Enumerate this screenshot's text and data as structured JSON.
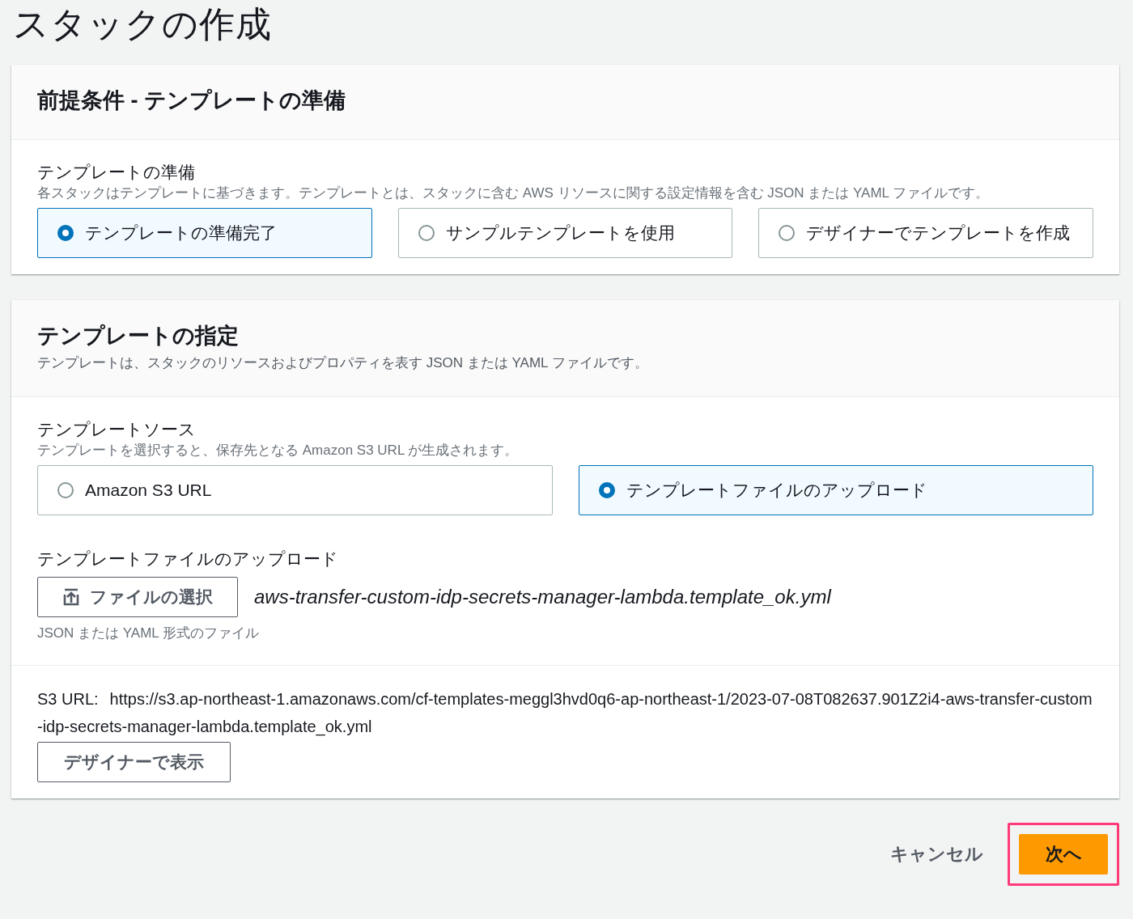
{
  "page_title": "スタックの作成",
  "prerequisite": {
    "heading": "前提条件 - テンプレートの準備",
    "field": {
      "label": "テンプレートの準備",
      "description": "各スタックはテンプレートに基づきます。テンプレートとは、スタックに含む AWS リソースに関する設定情報を含む JSON または YAML ファイルです。",
      "options": [
        {
          "label": "テンプレートの準備完了",
          "selected": true
        },
        {
          "label": "サンプルテンプレートを使用",
          "selected": false
        },
        {
          "label": "デザイナーでテンプレートを作成",
          "selected": false
        }
      ]
    }
  },
  "template_spec": {
    "heading": "テンプレートの指定",
    "description": "テンプレートは、スタックのリソースおよびプロパティを表す JSON または YAML ファイルです。",
    "source": {
      "label": "テンプレートソース",
      "description": "テンプレートを選択すると、保存先となる Amazon S3 URL が生成されます。",
      "options": [
        {
          "label": "Amazon S3 URL",
          "selected": false
        },
        {
          "label": "テンプレートファイルのアップロード",
          "selected": true
        }
      ]
    },
    "upload": {
      "label": "テンプレートファイルのアップロード",
      "button": "ファイルの選択",
      "file_name": "aws-transfer-custom-idp-secrets-manager-lambda.template_ok.yml",
      "hint": "JSON または YAML 形式のファイル"
    },
    "s3_url": {
      "label": "S3 URL:",
      "value": "https://s3.ap-northeast-1.amazonaws.com/cf-templates-meggl3hvd0q6-ap-northeast-1/2023-07-08T082637.901Z2i4-aws-transfer-custom-idp-secrets-manager-lambda.template_ok.yml"
    },
    "designer_button": "デザイナーで表示"
  },
  "footer": {
    "cancel": "キャンセル",
    "next": {
      "label": "次へ",
      "highlighted": true
    }
  }
}
